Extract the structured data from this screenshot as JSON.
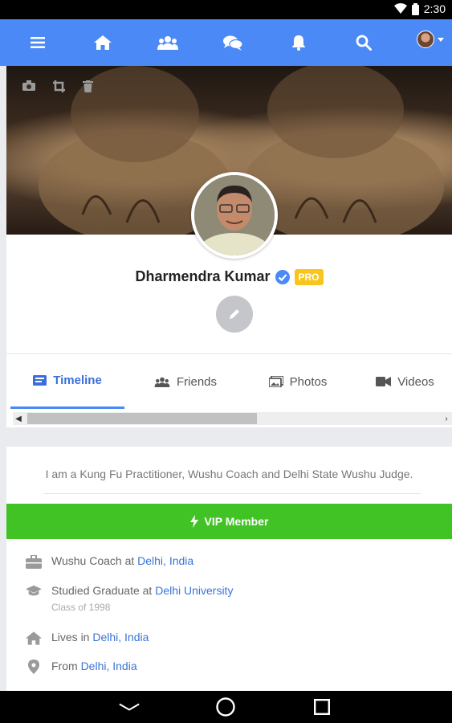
{
  "status": {
    "time": "2:30"
  },
  "appbar": {
    "icons": [
      "menu-icon",
      "home-icon",
      "friends-icon",
      "chat-icon",
      "bell-icon",
      "search-icon",
      "avatar"
    ],
    "color": "#4b89f7"
  },
  "profile": {
    "name": "Dharmendra Kumar",
    "badge": "PRO",
    "verified_icon": "verified-check-icon",
    "cover_tools": [
      "camera-icon",
      "crop-icon",
      "trash-icon"
    ]
  },
  "tabs": [
    {
      "label": "Timeline",
      "icon": "timeline-icon",
      "active": true
    },
    {
      "label": "Friends",
      "icon": "friends-icon",
      "active": false
    },
    {
      "label": "Photos",
      "icon": "photos-icon",
      "active": false
    },
    {
      "label": "Videos",
      "icon": "videos-icon",
      "active": false
    }
  ],
  "about": {
    "bio": "I am a Kung Fu Practitioner, Wushu Coach and Delhi State Wushu Judge.",
    "vip_label": "VIP Member",
    "vip_color": "#42c325",
    "work": {
      "prefix": "Wushu Coach at ",
      "link": "Delhi, India"
    },
    "education": {
      "prefix": "Studied Graduate at ",
      "link": "Delhi University",
      "sub": "Class of 1998"
    },
    "lives": {
      "prefix": "Lives in ",
      "link": "Delhi, India"
    },
    "from": {
      "prefix": "From ",
      "link": "Delhi, India"
    }
  },
  "navbar": {
    "icons": [
      "back-icon",
      "home-circle-icon",
      "recents-icon"
    ]
  }
}
